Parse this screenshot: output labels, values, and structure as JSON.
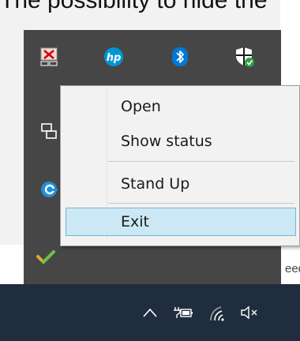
{
  "caption": {
    "text": "The possibility to hide the \"Exit"
  },
  "page": {
    "fragment_text": "eed"
  },
  "tray_flyout": {
    "icons": [
      {
        "name": "network-disconnected-icon"
      },
      {
        "name": "hp-icon"
      },
      {
        "name": "bluetooth-icon"
      },
      {
        "name": "windows-security-icon"
      },
      {
        "name": "remote-desktop-icon"
      },
      {
        "name": "edge-icon"
      },
      {
        "name": "checkmark-app-icon"
      }
    ]
  },
  "context_menu": {
    "items": [
      {
        "label": "Open"
      },
      {
        "label": "Show status"
      },
      {
        "label": "Stand Up"
      },
      {
        "label": "Exit",
        "highlighted": true
      }
    ]
  },
  "taskbar": {
    "icons": [
      {
        "name": "chevron-up-icon"
      },
      {
        "name": "battery-plug-icon"
      },
      {
        "name": "wifi-icon"
      },
      {
        "name": "volume-muted-icon"
      }
    ]
  },
  "colors": {
    "flyout_bg": "#464646",
    "menu_highlight": "#cce8f4",
    "menu_highlight_border": "#78b4dc",
    "taskbar_bg": "#1f2d3e",
    "hp_blue": "#0096d6",
    "bluetooth_blue": "#0078d7",
    "shield_green": "#2ea043",
    "edge_blue": "#1e90d6"
  }
}
